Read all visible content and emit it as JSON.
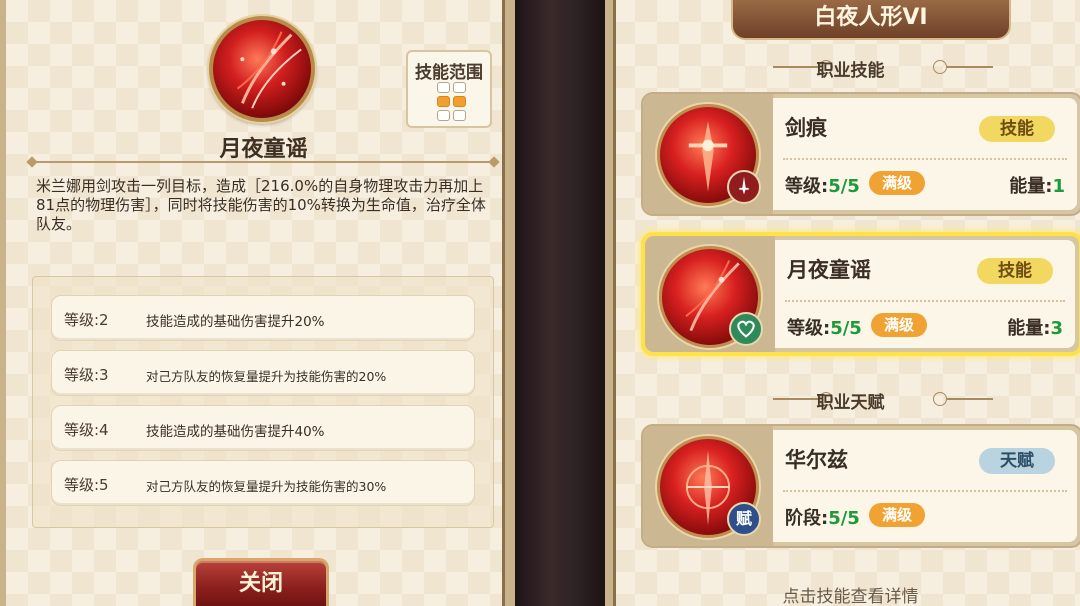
{
  "skill_detail": {
    "name": "月夜童谣",
    "range_title": "技能范围",
    "range_cells": [
      false,
      false,
      true,
      true,
      false,
      false
    ],
    "description": "米兰娜用剑攻击一列目标，造成［216.0%的自身物理攻击力再加上81点的物理伤害］，同时将技能伤害的10%转换为生命值，治疗全体队友。",
    "levels": [
      {
        "level": "等级:2",
        "effect": "技能造成的基础伤害提升20%"
      },
      {
        "level": "等级:3",
        "effect": "对己方队友的恢复量提升为技能伤害的20%"
      },
      {
        "level": "等级:4",
        "effect": "技能造成的基础伤害提升40%"
      },
      {
        "level": "等级:5",
        "effect": "对己方队友的恢复量提升为技能伤害的30%"
      }
    ],
    "close_label": "关闭"
  },
  "class_panel": {
    "banner": "白夜人形VI",
    "skills_section": "职业技能",
    "talent_section": "职业天赋",
    "cards": [
      {
        "name": "剑痕",
        "tag": "技能",
        "level_label": "等级:",
        "level_value": "5/5",
        "max_tag": "满级",
        "energy_label": "能量:",
        "energy_value": "1",
        "badge": "sword-badge"
      },
      {
        "name": "月夜童谣",
        "tag": "技能",
        "level_label": "等级:",
        "level_value": "5/5",
        "max_tag": "满级",
        "energy_label": "能量:",
        "energy_value": "3",
        "badge": "heart-badge",
        "selected": true
      },
      {
        "name": "华尔兹",
        "tag": "天赋",
        "level_label": "阶段:",
        "level_value": "5/5",
        "max_tag": "满级",
        "badge_text": "赋"
      }
    ],
    "hint": "点击技能查看详情"
  },
  "colors": {
    "panel_bg": "#f6efdf",
    "close_button": "#8c1f1c",
    "skill_tag": "#f2d860",
    "talent_tag": "#b9d3e0",
    "max_tag": "#f0a232",
    "value_green": "#1f9a3a",
    "selected_border": "#ffe14a"
  }
}
